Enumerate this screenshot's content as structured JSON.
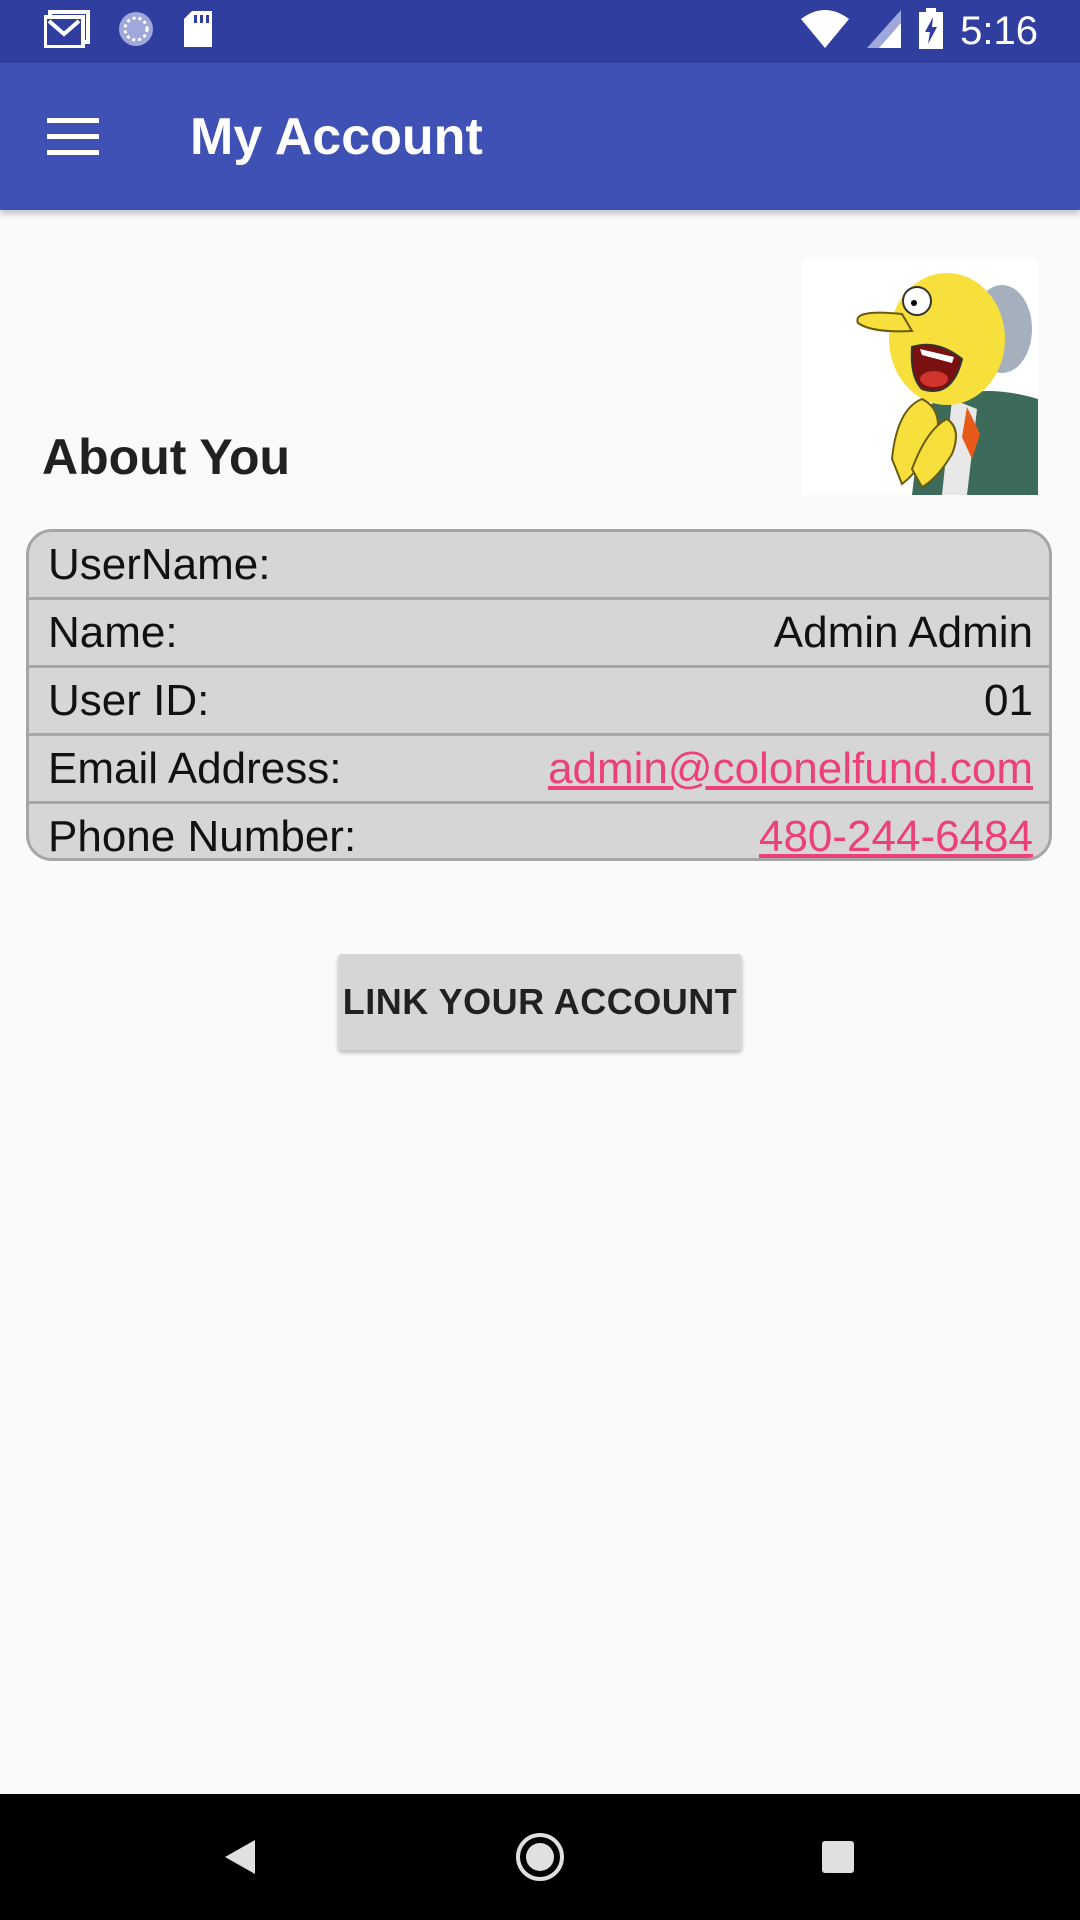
{
  "status_bar": {
    "time": "5:16",
    "icons": [
      "gmail-icon",
      "sync-icon",
      "sd-card-icon",
      "wifi-icon",
      "signal-icon",
      "battery-charging-icon"
    ]
  },
  "toolbar": {
    "menu_icon": "hamburger-menu-icon",
    "title": "My Account"
  },
  "profile": {
    "avatar_icon": "cartoon-avatar-image",
    "section_title": "About You"
  },
  "info_rows": [
    {
      "label": "UserName:",
      "value": ""
    },
    {
      "label": "Name:",
      "value": "Admin Admin"
    },
    {
      "label": "User ID:",
      "value": "01"
    },
    {
      "label": "Email Address:",
      "value": "admin@colonelfund.com"
    },
    {
      "label": "Phone Number:",
      "value": "480-244-6484"
    }
  ],
  "actions": {
    "link_account_label": "LINK YOUR ACCOUNT"
  },
  "nav_bar": {
    "icons": [
      "back-icon",
      "home-icon",
      "recents-icon"
    ]
  },
  "colors": {
    "status_bar": "#303f9f",
    "toolbar": "#3f51b5",
    "link": "#ec407a",
    "table_bg": "#d6d6d6"
  }
}
